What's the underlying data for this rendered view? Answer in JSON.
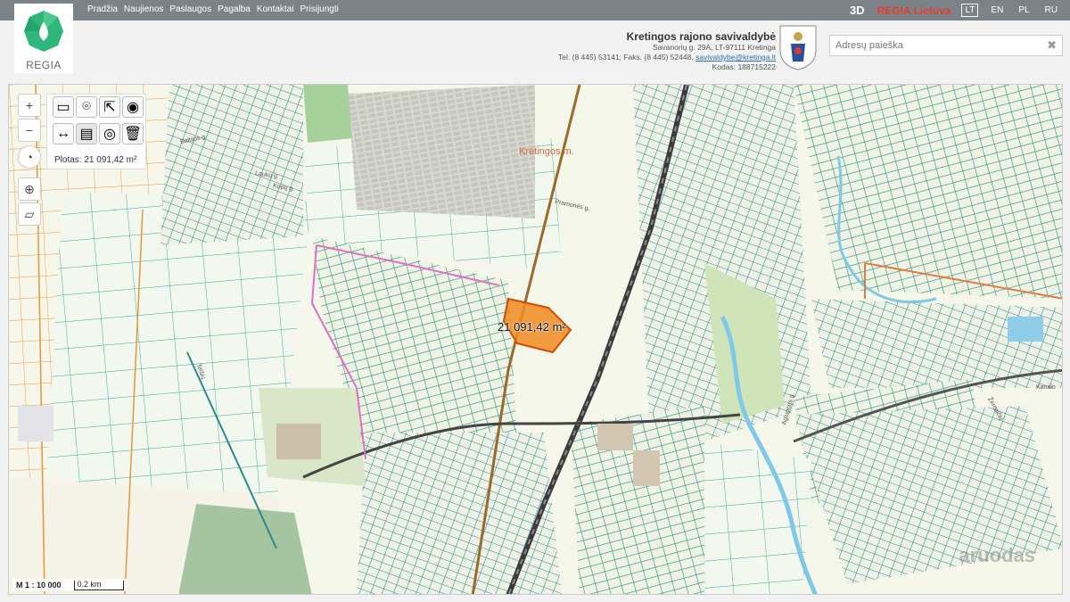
{
  "nav": [
    "Pradžia",
    "Naujienos",
    "Paslaugos",
    "Pagalba",
    "Kontaktai",
    "Prisijungti"
  ],
  "top_right": {
    "btn_3d": "3D",
    "regia_lt": "REGIA Lietuva",
    "langs": [
      "LT",
      "EN",
      "PL",
      "RU"
    ],
    "active_lang": "LT"
  },
  "logo": {
    "text": "REGIA"
  },
  "municipality": {
    "name": "Kretingos rajono savivaldybė",
    "address": "Savanorių g. 29A, LT-97111 Kretinga",
    "phone_prefix": "Tel. (8 445) 53141; Faks. (8 445) 52448,",
    "email": "savivaldybe@kretinga.lt",
    "code": "Kodas: 188715222"
  },
  "search": {
    "placeholder": "Adresų paieška",
    "clear": "✖"
  },
  "map": {
    "plotas": "Plotas: 21 091,42 m²",
    "measure_label": "21 091,42 m²",
    "town_label": "Kretingos m.",
    "streets": [
      "Baltijos g.",
      "Laukų g.",
      "Kopų g.",
      "Telšių",
      "Pramonės g.",
      "Agluonos g.",
      "Kanalo",
      "Žemaičių"
    ],
    "scale_ratio": "M 1 : 10 000",
    "scale_bar": "0.2 km",
    "watermark": "aruodas"
  }
}
